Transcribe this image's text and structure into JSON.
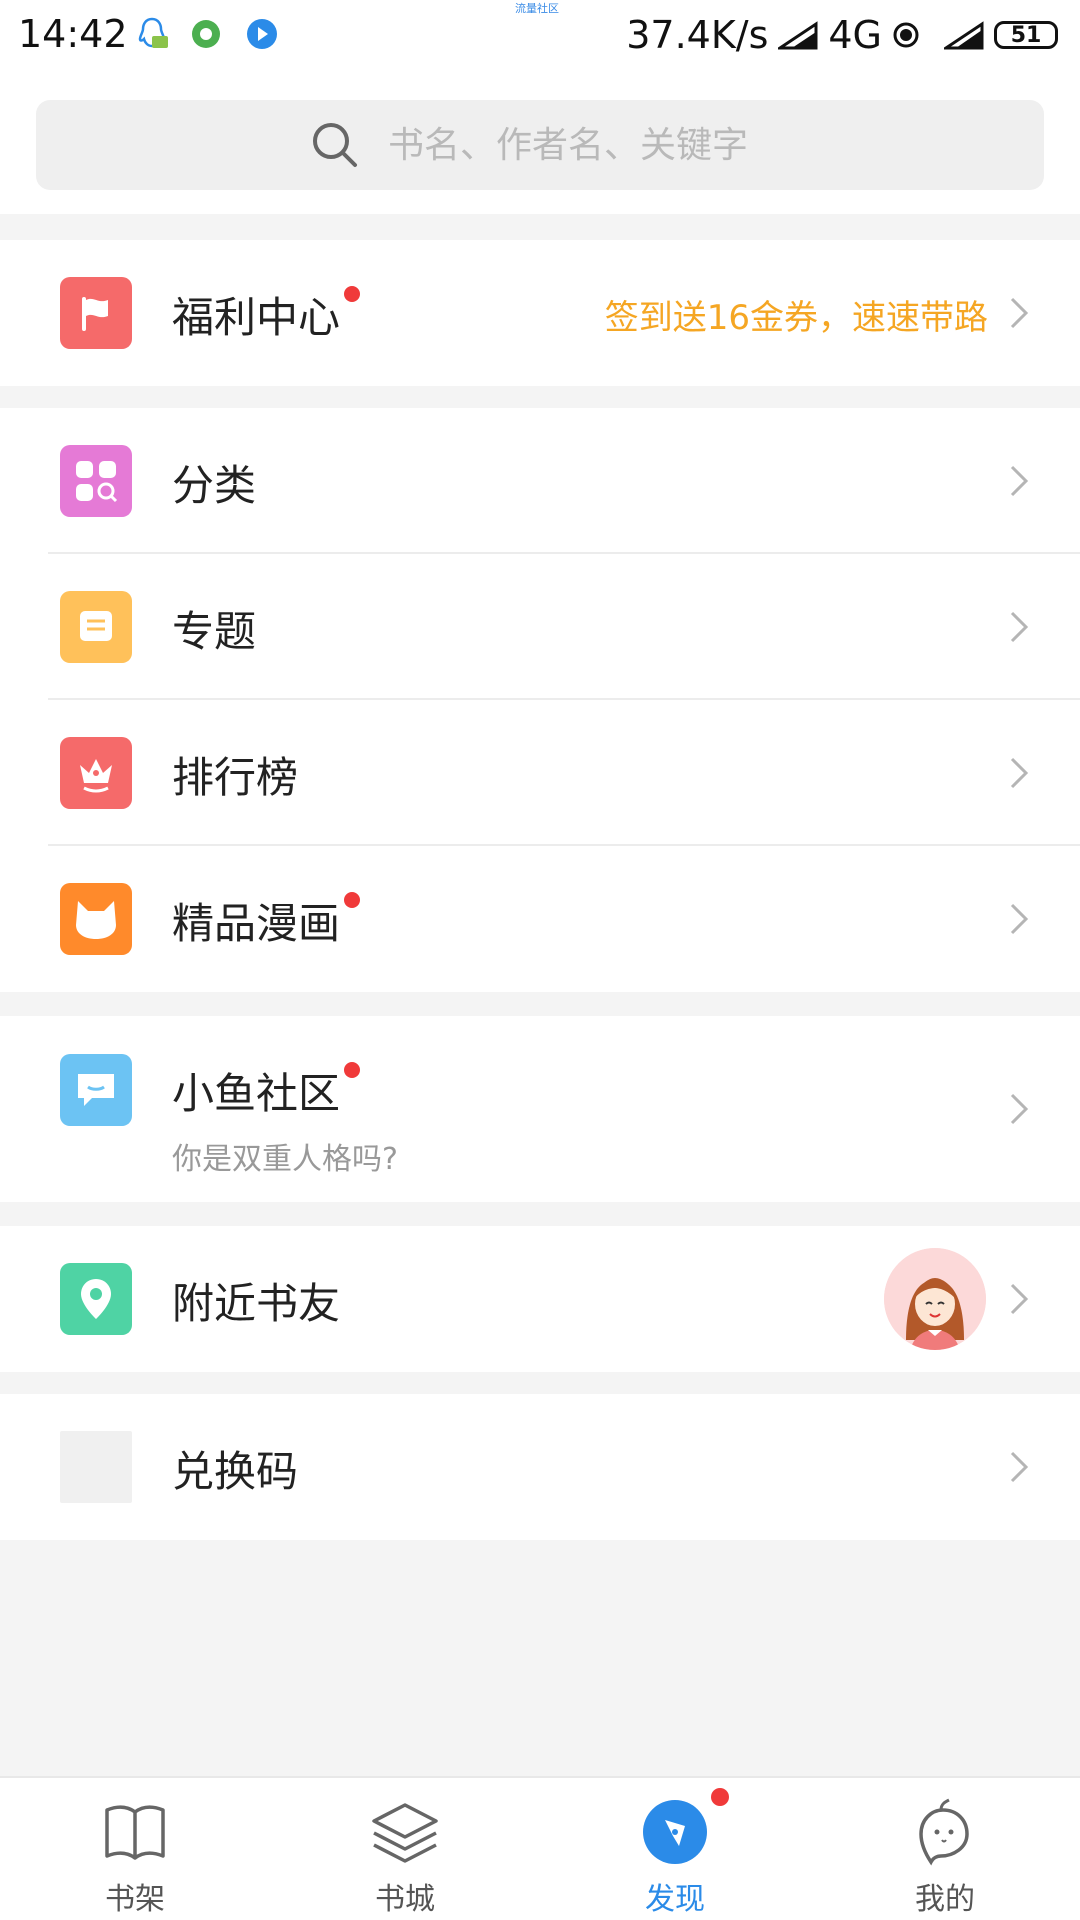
{
  "status_bar": {
    "time": "14:42",
    "tiny_text": "流量社区",
    "net_speed": "37.4K/s",
    "network": "4G",
    "battery": "51"
  },
  "search": {
    "placeholder": "书名、作者名、关键字"
  },
  "welfare": {
    "title": "福利中心",
    "hint": "签到送16金券，速速带路",
    "hint_color": "#f5a623",
    "icon": "flag-icon",
    "icon_color": "#f56a6a"
  },
  "menu": {
    "category": {
      "title": "分类",
      "icon": "category-icon",
      "icon_color": "#e57ad6"
    },
    "topic": {
      "title": "专题",
      "icon": "topic-icon",
      "icon_color": "#ffc15a"
    },
    "ranking": {
      "title": "排行榜",
      "icon": "crown-icon",
      "icon_color": "#f56a6a"
    },
    "comics": {
      "title": "精品漫画",
      "icon": "cat-icon",
      "icon_color": "#ff8a2b"
    }
  },
  "community": {
    "title": "小鱼社区",
    "subtitle": "你是双重人格吗?",
    "icon": "chat-icon",
    "icon_color": "#6cc3f3"
  },
  "nearby": {
    "title": "附近书友",
    "icon": "location-icon",
    "icon_color": "#4fd3a4"
  },
  "redeem": {
    "title": "兑换码"
  },
  "tabs": [
    {
      "label": "书架",
      "icon": "book-icon"
    },
    {
      "label": "书城",
      "icon": "layers-icon"
    },
    {
      "label": "发现",
      "icon": "compass-icon",
      "active": true
    },
    {
      "label": "我的",
      "icon": "mascot-icon"
    }
  ],
  "colors": {
    "accent": "#2b8be8",
    "badge": "#f03a3a",
    "background": "#f4f4f4"
  }
}
